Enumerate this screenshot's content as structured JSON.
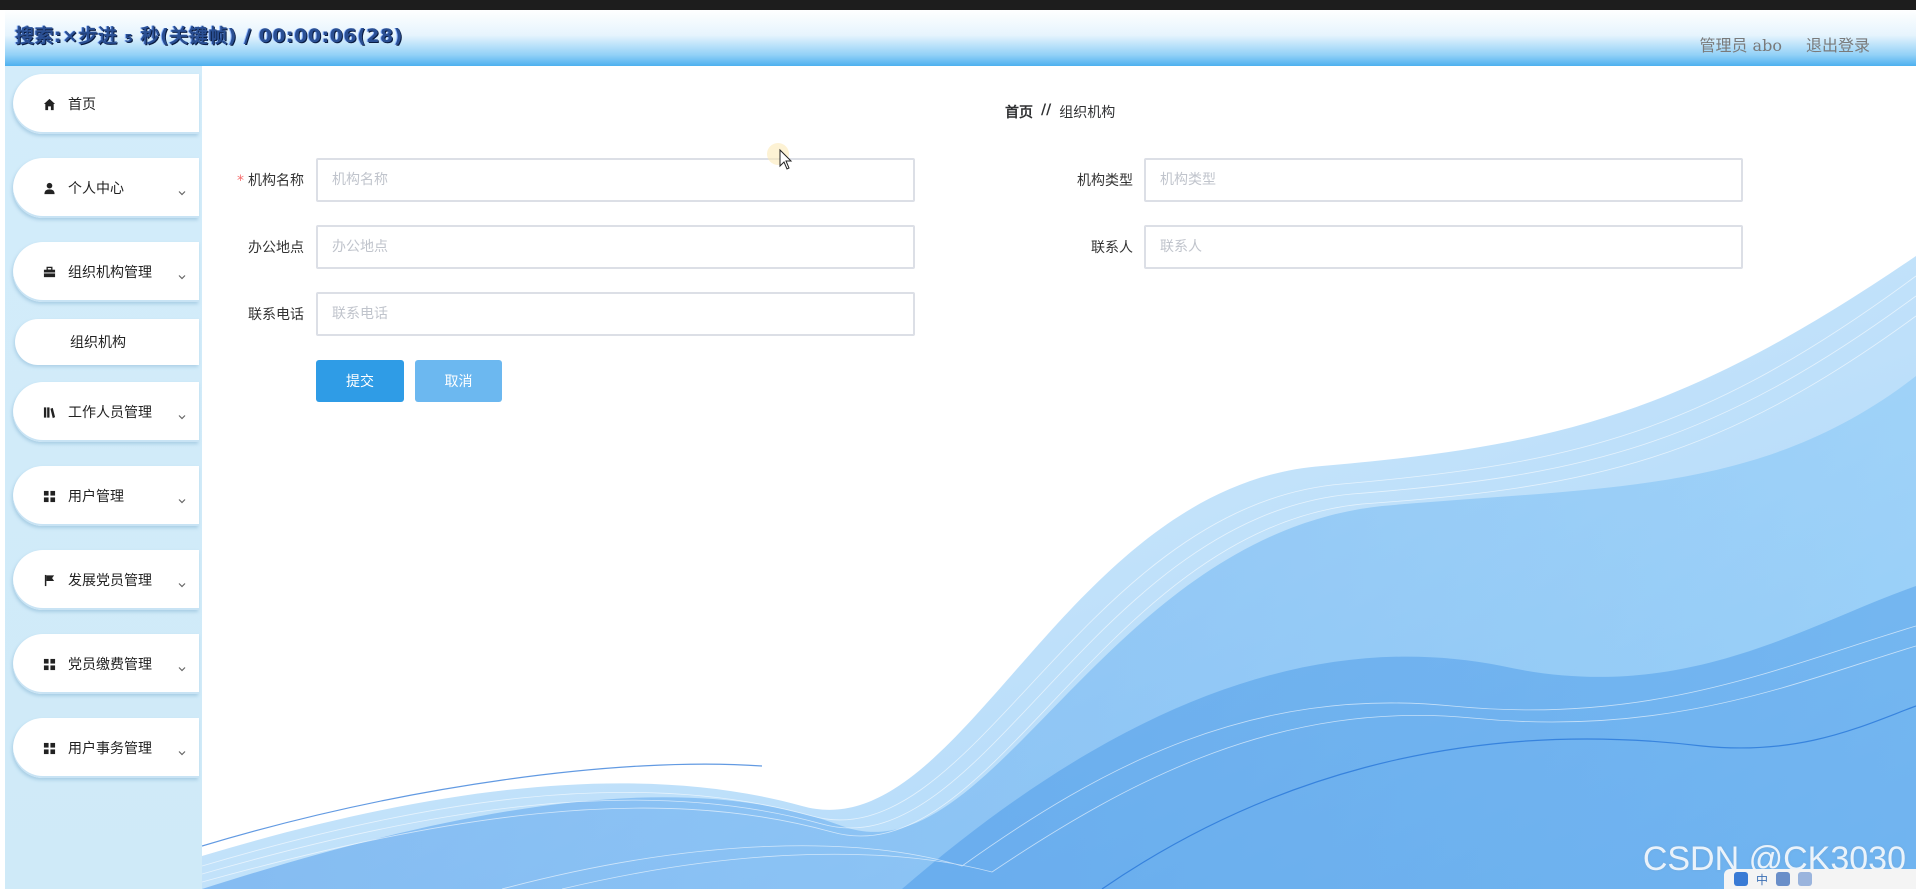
{
  "header": {
    "title": "搜索:×步进 ₅ 秒(关键帧) / 00:00:06(28)",
    "admin_label": "管理员 abo",
    "logout_label": "退出登录"
  },
  "sidebar": {
    "items": [
      {
        "label": "首页",
        "icon": "home-icon"
      },
      {
        "label": "个人中心",
        "icon": "user-icon"
      },
      {
        "label": "组织机构管理",
        "icon": "briefcase-icon"
      },
      {
        "label": "工作人员管理",
        "icon": "library-icon"
      },
      {
        "label": "用户管理",
        "icon": "grid-icon"
      },
      {
        "label": "发展党员管理",
        "icon": "flag-icon"
      },
      {
        "label": "党员缴费管理",
        "icon": "grid-icon"
      },
      {
        "label": "用户事务管理",
        "icon": "grid-icon"
      }
    ],
    "sub_item": {
      "label": "组织机构"
    }
  },
  "breadcrumb": {
    "home": "首页",
    "separator": "//",
    "current": "组织机构"
  },
  "form": {
    "org_name": {
      "label": "机构名称",
      "placeholder": "机构名称",
      "required_mark": "*"
    },
    "org_type": {
      "label": "机构类型",
      "placeholder": "机构类型"
    },
    "office_location": {
      "label": "办公地点",
      "placeholder": "办公地点"
    },
    "contact_person": {
      "label": "联系人",
      "placeholder": "联系人"
    },
    "contact_phone": {
      "label": "联系电话",
      "placeholder": "联系电话"
    },
    "submit_label": "提交",
    "cancel_label": "取消"
  },
  "watermark": "CSDN @CK3030",
  "tray": {
    "ime_label": "中"
  },
  "colors": {
    "primary_button": "#2f9ce6",
    "cancel_button": "#6cb8f0",
    "required": "#f56c6c",
    "sidebar_bg": "#d3ecfa",
    "header_gradient_end": "#4db0ef"
  }
}
